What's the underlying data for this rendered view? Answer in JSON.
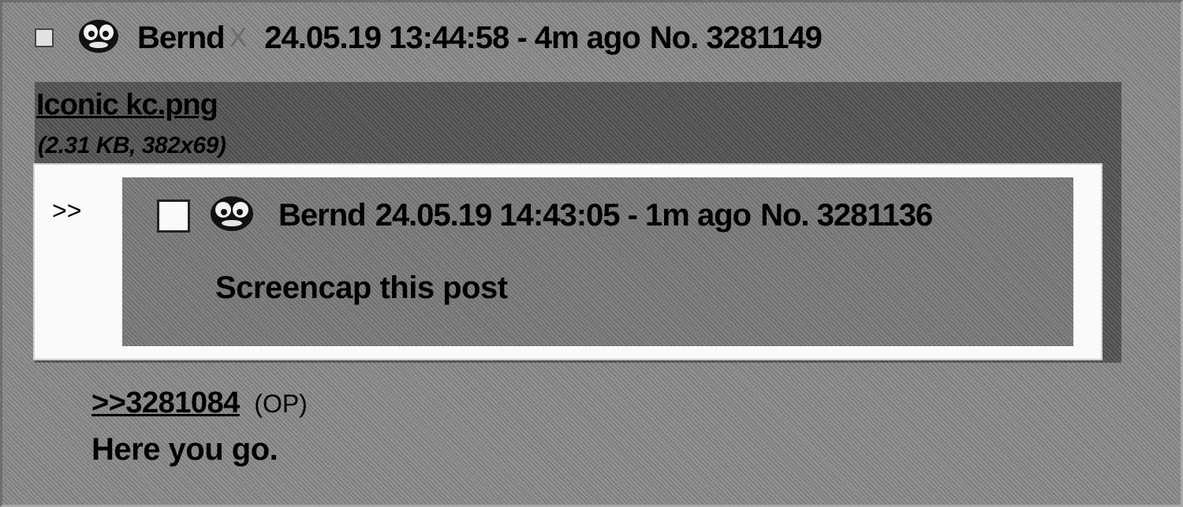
{
  "post": {
    "name": "Bernd",
    "delete_mark": "X",
    "timestamp": "24.05.19 13:44:58 - 4m ago",
    "number": "No. 3281149",
    "file": {
      "name": "Iconic kc.png",
      "info": "(2.31 KB, 382x69)"
    },
    "reply_link": ">>3281084",
    "reply_tag": "(OP)",
    "body": "Here you go."
  },
  "preview": {
    "arrows": ">>",
    "name": "Bernd",
    "timestamp": "24.05.19 14:43:05 - 1m ago",
    "number": "No. 3281136",
    "body": "Screencap this post"
  },
  "icons": {
    "avatar": "bernd-face-icon",
    "checkbox": "checkbox"
  }
}
